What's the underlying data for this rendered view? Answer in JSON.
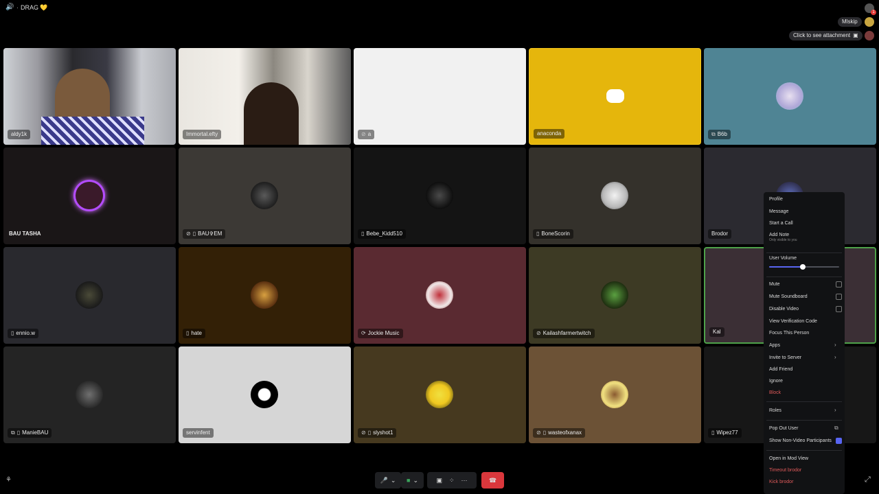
{
  "window": {
    "channel_prefix": "·",
    "channel_name": "DRAG",
    "channel_emoji": "💛",
    "notification_count": "1"
  },
  "top_right": {
    "user_pill": "Mlskip",
    "attachment_pill": "Click to see attachment"
  },
  "tiles": [
    {
      "name": "aldy1k",
      "bg": "#3b3a46"
    },
    {
      "name": "Immortal.efty",
      "bg": "#6b6660"
    },
    {
      "name": "a",
      "bg": "#f1f1f1"
    },
    {
      "name": "anaconda",
      "bg": "#e5b60c"
    },
    {
      "name": "B6b",
      "bg": "#4f8494"
    },
    {
      "name": "BAU TASHA",
      "bg": "#1a1617"
    },
    {
      "name": "BAU✞EM",
      "bg": "#3c3935"
    },
    {
      "name": "Bebe_Kidd510",
      "bg": "#141414"
    },
    {
      "name": "BoneScorin",
      "bg": "#34312b"
    },
    {
      "name": "Brodor",
      "bg": "#2b2a30"
    },
    {
      "name": "ennio.w",
      "bg": "#29292e"
    },
    {
      "name": "hate",
      "bg": "#332006"
    },
    {
      "name": "Jockie Music",
      "bg": "#5a2a31"
    },
    {
      "name": "Kailashfarmertwitch",
      "bg": "#3d3a24"
    },
    {
      "name": "Kal",
      "bg": "#3b2f35"
    },
    {
      "name": "ManieBAU",
      "bg": "#242424"
    },
    {
      "name": "servinfent",
      "bg": "#d6d6d6"
    },
    {
      "name": "slyshot1",
      "bg": "#46391f"
    },
    {
      "name": "wasteofxanax",
      "bg": "#6c5236"
    },
    {
      "name": "Wipez77",
      "bg": "#171717"
    }
  ],
  "context_menu": {
    "profile": "Profile",
    "message": "Message",
    "start_call": "Start a Call",
    "add_note": "Add Note",
    "add_note_sub": "Only visible to you",
    "user_volume": "User Volume",
    "user_volume_level": 0.48,
    "mute": "Mute",
    "mute_soundboard": "Mute Soundboard",
    "disable_video": "Disable Video",
    "view_verification": "View Verification Code",
    "focus_person": "Focus This Person",
    "apps": "Apps",
    "invite_server": "Invite to Server",
    "add_friend": "Add Friend",
    "ignore": "Ignore",
    "block": "Block",
    "roles": "Roles",
    "pop_out": "Pop Out User",
    "show_non_video": "Show Non-Video Participants",
    "open_mod_view": "Open in Mod View",
    "timeout": "Timeout brodor",
    "kick": "Kick brodor"
  },
  "colors": {
    "accent": "#5865f2",
    "danger": "#da373c",
    "speaking_ring": "#4ea24a"
  },
  "icons": {
    "mic": "🎤",
    "camera": "📹",
    "screen": "🖥",
    "activity": "✚",
    "more": "···",
    "hangup": "☎",
    "phone": "📱",
    "deafened": "🔇"
  }
}
